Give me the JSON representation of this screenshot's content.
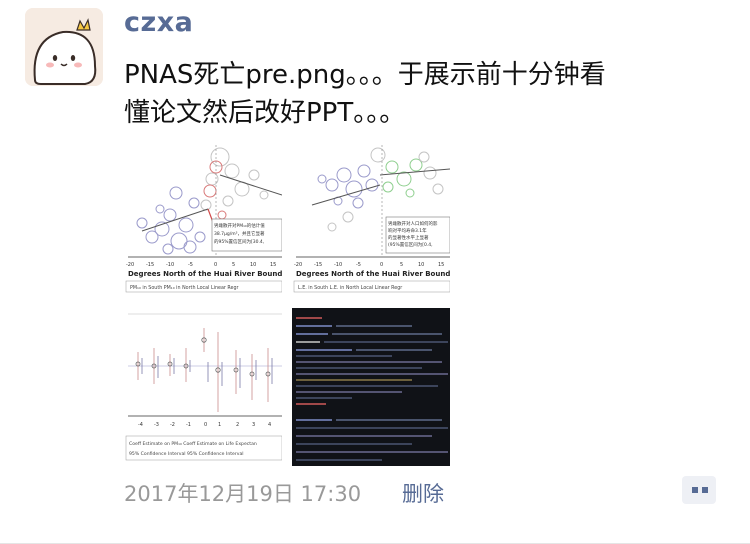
{
  "post": {
    "author": "czxa",
    "text": "PNAS死亡pre.png。。。于展示前十分钟看\n懂论文然后改好PPT。。。",
    "time": "2017年12月19日 17:30",
    "delete_label": "删除"
  },
  "thumbs": {
    "t1": {
      "xlabel": "Degrees North of the Huai River Bounda",
      "ticks": [
        "-20",
        "-15",
        "-10",
        "-5",
        "0",
        "5",
        "10",
        "15"
      ],
      "legend": "PM₁₀ in South    PM₁₀ in North    Local Linear Regr",
      "note": "男雌散开对PM₁₀的估计值\n38.7μg/m³，并且它显著\n的95%置信区间为[30.4,"
    },
    "t2": {
      "xlabel": "Degrees North of the Huai River Bounda",
      "ticks": [
        "-20",
        "-15",
        "-10",
        "-5",
        "0",
        "5",
        "10",
        "15"
      ],
      "legend": "L.E. in South    L.E. in North    Local Linear Regr",
      "note": "男雌散开对人口如何的影\n响对平均寿命3.1年\n的显著性水平上显著\n(95%置信区间为[0.4,"
    },
    "t3": {
      "ticks": [
        "-4",
        "-3",
        "-2",
        "-1",
        "0",
        "1",
        "2",
        "3",
        "4"
      ],
      "legend1": "Coeff Estimate on PM₁₀    Coeff Estimate on Life Expectan",
      "legend2": "95% Confidence Interval    95% Confidence Interval"
    }
  },
  "colors": {
    "link": "#576b95",
    "muted": "#999999",
    "text": "#111111"
  },
  "icons": {
    "avatar": "white-bunny-avatar-icon",
    "comment": "comment-dots-icon"
  }
}
